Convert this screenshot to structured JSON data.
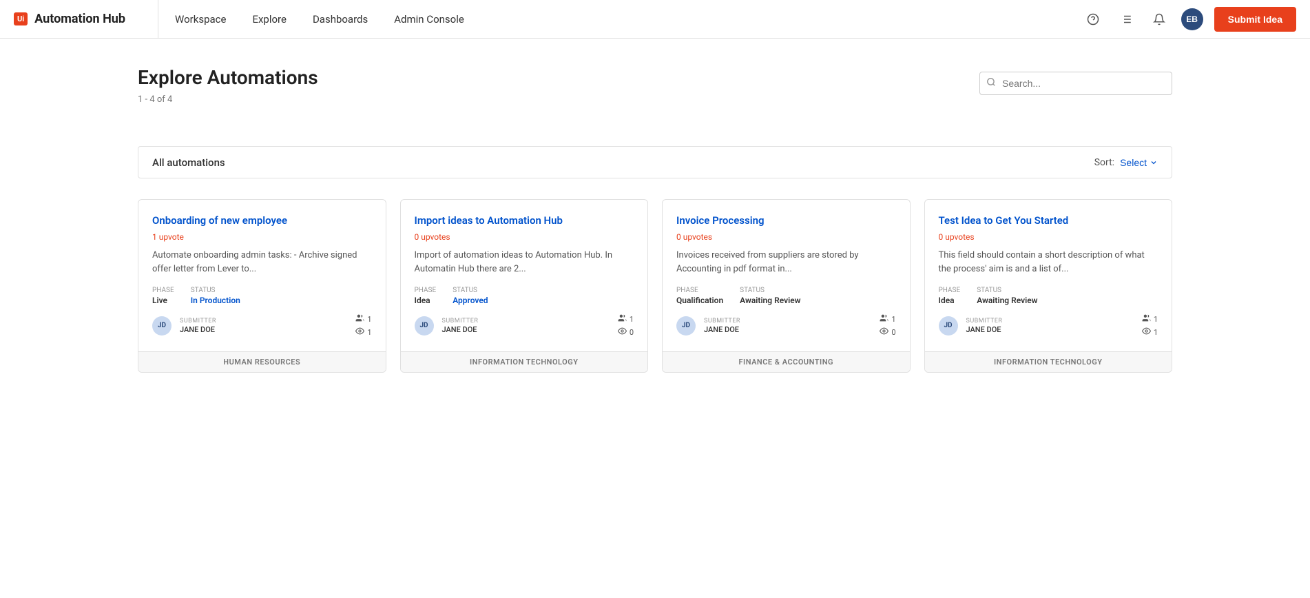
{
  "app": {
    "logo_icon": "Ui",
    "logo_text": "Automation Hub",
    "nav": [
      {
        "id": "workspace",
        "label": "Workspace"
      },
      {
        "id": "explore",
        "label": "Explore"
      },
      {
        "id": "dashboards",
        "label": "Dashboards"
      },
      {
        "id": "admin-console",
        "label": "Admin Console"
      }
    ],
    "avatar_initials": "EB",
    "submit_button_label": "Submit Idea"
  },
  "page": {
    "title": "Explore Automations",
    "count_text": "1 - 4 of 4",
    "search_placeholder": "Search..."
  },
  "filter_bar": {
    "label": "All automations",
    "sort_label": "Sort:",
    "sort_value": "Select"
  },
  "cards": [
    {
      "id": "card-1",
      "title": "Onboarding of new employee",
      "upvotes": "1 upvote",
      "description": "Automate onboarding admin tasks: - Archive signed offer letter from Lever to...",
      "phase_label": "Phase",
      "phase_value": "Live",
      "status_label": "Status",
      "status_value": "In Production",
      "status_class": "in-production",
      "submitter_label": "SUBMITTER",
      "submitter_name": "JANE DOE",
      "submitter_initials": "JD",
      "followers": "1",
      "views": "1",
      "category": "HUMAN RESOURCES"
    },
    {
      "id": "card-2",
      "title": "Import ideas to Automation Hub",
      "upvotes": "0 upvotes",
      "description": "Import of automation ideas to Automation Hub. In Automatin Hub there are 2...",
      "phase_label": "Phase",
      "phase_value": "Idea",
      "status_label": "Status",
      "status_value": "Approved",
      "status_class": "approved",
      "submitter_label": "SUBMITTER",
      "submitter_name": "JANE DOE",
      "submitter_initials": "JD",
      "followers": "1",
      "views": "0",
      "category": "INFORMATION TECHNOLOGY"
    },
    {
      "id": "card-3",
      "title": "Invoice Processing",
      "upvotes": "0 upvotes",
      "description": "Invoices received from suppliers are stored by Accounting in pdf format in...",
      "phase_label": "Phase",
      "phase_value": "Qualification",
      "status_label": "Status",
      "status_value": "Awaiting Review",
      "status_class": "awaiting-review",
      "submitter_label": "SUBMITTER",
      "submitter_name": "JANE DOE",
      "submitter_initials": "JD",
      "followers": "1",
      "views": "0",
      "category": "FINANCE & ACCOUNTING"
    },
    {
      "id": "card-4",
      "title": "Test Idea to Get You Started",
      "upvotes": "0 upvotes",
      "description": "This field should contain a short description of what the process' aim is and a list of...",
      "phase_label": "Phase",
      "phase_value": "Idea",
      "status_label": "Status",
      "status_value": "Awaiting Review",
      "status_class": "awaiting-review",
      "submitter_label": "SUBMITTER",
      "submitter_name": "JANE DOE",
      "submitter_initials": "JD",
      "followers": "1",
      "views": "1",
      "category": "INFORMATION TECHNOLOGY"
    }
  ]
}
